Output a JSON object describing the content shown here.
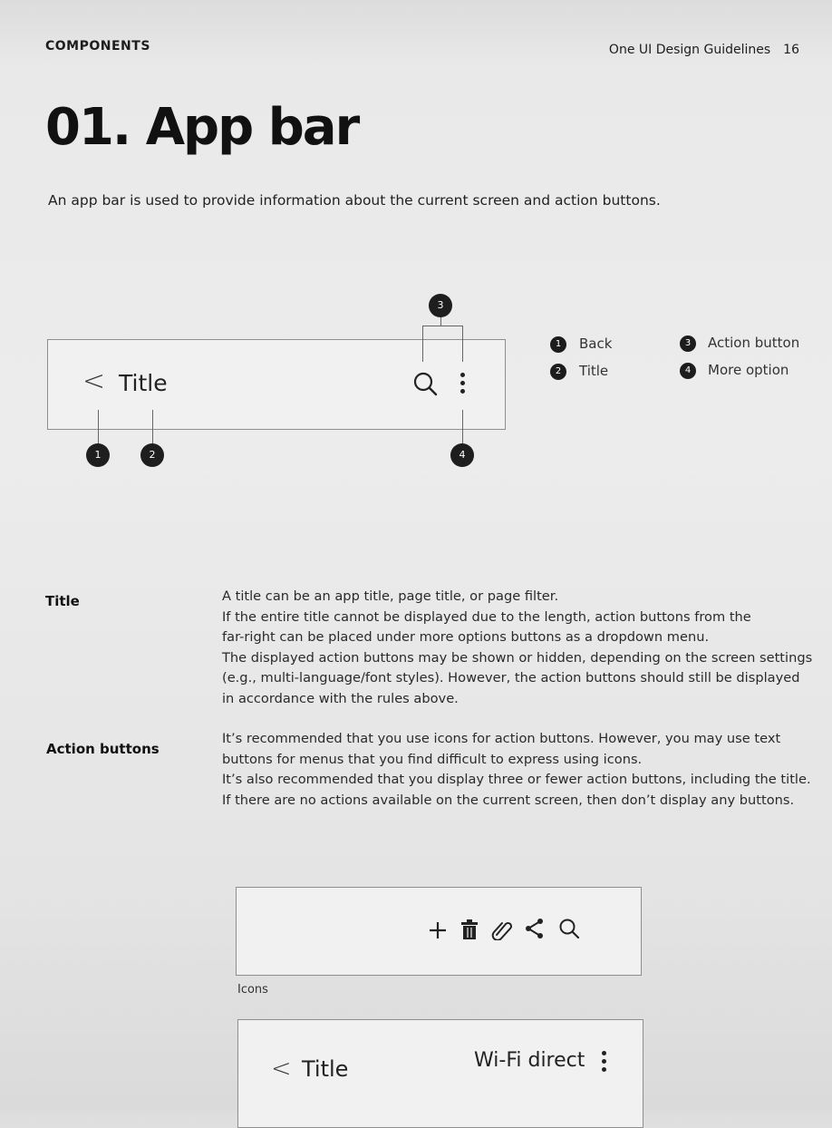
{
  "header": {
    "section": "COMPONENTS",
    "doc_title": "One UI Design Guidelines",
    "page_number": "16"
  },
  "heading": "01. App bar",
  "intro": "An app bar is used to provide information about the current screen and action buttons.",
  "diagram": {
    "back_glyph": "<",
    "title_sample": "Title",
    "badges": [
      "1",
      "2",
      "3",
      "4"
    ],
    "icons": [
      "chevron-left-icon",
      "search-icon",
      "more-vertical-icon"
    ]
  },
  "legend": [
    {
      "num": "1",
      "label": "Back"
    },
    {
      "num": "2",
      "label": "Title"
    },
    {
      "num": "3",
      "label": "Action button"
    },
    {
      "num": "4",
      "label": "More option"
    }
  ],
  "rows": [
    {
      "term": "Title",
      "lines": [
        "A title can be an app title, page title, or page filter.",
        "If the entire title cannot be displayed due to the length, action buttons from the",
        "far-right can be placed under more options buttons as a dropdown menu.",
        "The displayed action buttons may be shown or hidden, depending on the screen settings",
        "(e.g., multi-language/font styles). However, the action buttons should still be displayed",
        "in accordance with the rules above."
      ]
    },
    {
      "term": "Action buttons",
      "lines": [
        "It’s recommended that you use icons for action buttons. However, you may use text",
        "buttons for menus that you find difficult to express using icons.",
        "It’s also recommended that you display three or fewer action buttons, including the title.",
        "If there are no actions available on the current screen, then don’t display any buttons."
      ]
    }
  ],
  "icons_example": {
    "caption": "Icons",
    "icons": [
      "plus-icon",
      "trash-icon",
      "paperclip-icon",
      "share-icon",
      "search-icon"
    ]
  },
  "wifi_example": {
    "back_glyph": "<",
    "title": "Title",
    "action_text": "Wi-Fi direct"
  }
}
